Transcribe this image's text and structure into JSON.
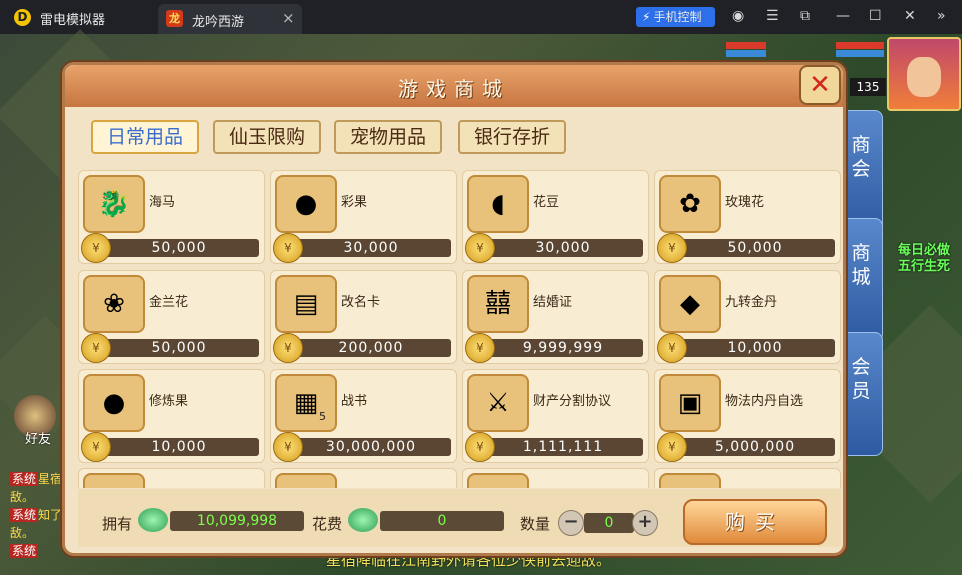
{
  "emulator": {
    "app_name": "雷电模拟器",
    "tab_title": "龙吟西游",
    "tab_close": "×",
    "phone_control_label": "手机控制",
    "window_icons": [
      "user-icon",
      "menu-icon",
      "restore-icon",
      "minimize-icon",
      "maximize-icon",
      "close-icon",
      "expand-icon"
    ]
  },
  "hud": {
    "level": "135",
    "side_tabs": [
      {
        "label": "商会"
      },
      {
        "label": "商城"
      },
      {
        "label": "会员"
      }
    ],
    "quest_lines": [
      "每日必做",
      "五行生死"
    ],
    "friend_label": "好友",
    "chat": [
      {
        "tag": "系统",
        "text": "星宿"
      },
      {
        "tag": "",
        "text": "敌。"
      },
      {
        "tag": "系统",
        "text": "知了"
      },
      {
        "tag": "",
        "text": "敌。"
      },
      {
        "tag": "系统",
        "text": ""
      }
    ],
    "ticker": "星宿降临在江南野外请各位少侠前去迎敌。"
  },
  "shop": {
    "title": "游戏商城",
    "close_label": "✕",
    "categories": [
      {
        "label": "日常用品",
        "active": true
      },
      {
        "label": "仙玉限购",
        "active": false
      },
      {
        "label": "宠物用品",
        "active": false
      },
      {
        "label": "银行存折",
        "active": false
      }
    ],
    "items": [
      {
        "name": "海马",
        "price": "50,000",
        "icon": "seahorse-icon",
        "glyph": "🐉"
      },
      {
        "name": "彩果",
        "price": "30,000",
        "icon": "fruit-icon",
        "glyph": "●"
      },
      {
        "name": "花豆",
        "price": "30,000",
        "icon": "bean-icon",
        "glyph": "◖"
      },
      {
        "name": "玫瑰花",
        "price": "50,000",
        "icon": "rose-icon",
        "glyph": "✿"
      },
      {
        "name": "金兰花",
        "price": "50,000",
        "icon": "orchid-icon",
        "glyph": "❀"
      },
      {
        "name": "改名卡",
        "price": "200,000",
        "icon": "rename-card-icon",
        "glyph": "▤"
      },
      {
        "name": "结婚证",
        "price": "9,999,999",
        "icon": "marriage-certificate-icon",
        "glyph": "囍"
      },
      {
        "name": "九转金丹",
        "price": "10,000",
        "icon": "golden-pill-icon",
        "glyph": "◆"
      },
      {
        "name": "修炼果",
        "price": "10,000",
        "icon": "training-fruit-icon",
        "glyph": "●"
      },
      {
        "name": "战书",
        "price": "30,000,000",
        "icon": "war-letter-icon",
        "glyph": "▦",
        "count": "5"
      },
      {
        "name": "财产分割协议",
        "price": "1,111,111",
        "icon": "property-agreement-icon",
        "glyph": "⚔"
      },
      {
        "name": "物法内丹自选",
        "price": "5,000,000",
        "icon": "treasure-chest-icon",
        "glyph": "▣"
      }
    ],
    "footer": {
      "own_label": "拥有",
      "own_value": "10,099,998",
      "cost_label": "花费",
      "cost_value": "0",
      "qty_label": "数量",
      "qty_value": "0",
      "minus": "−",
      "plus": "+",
      "buy_label": "购买"
    }
  }
}
